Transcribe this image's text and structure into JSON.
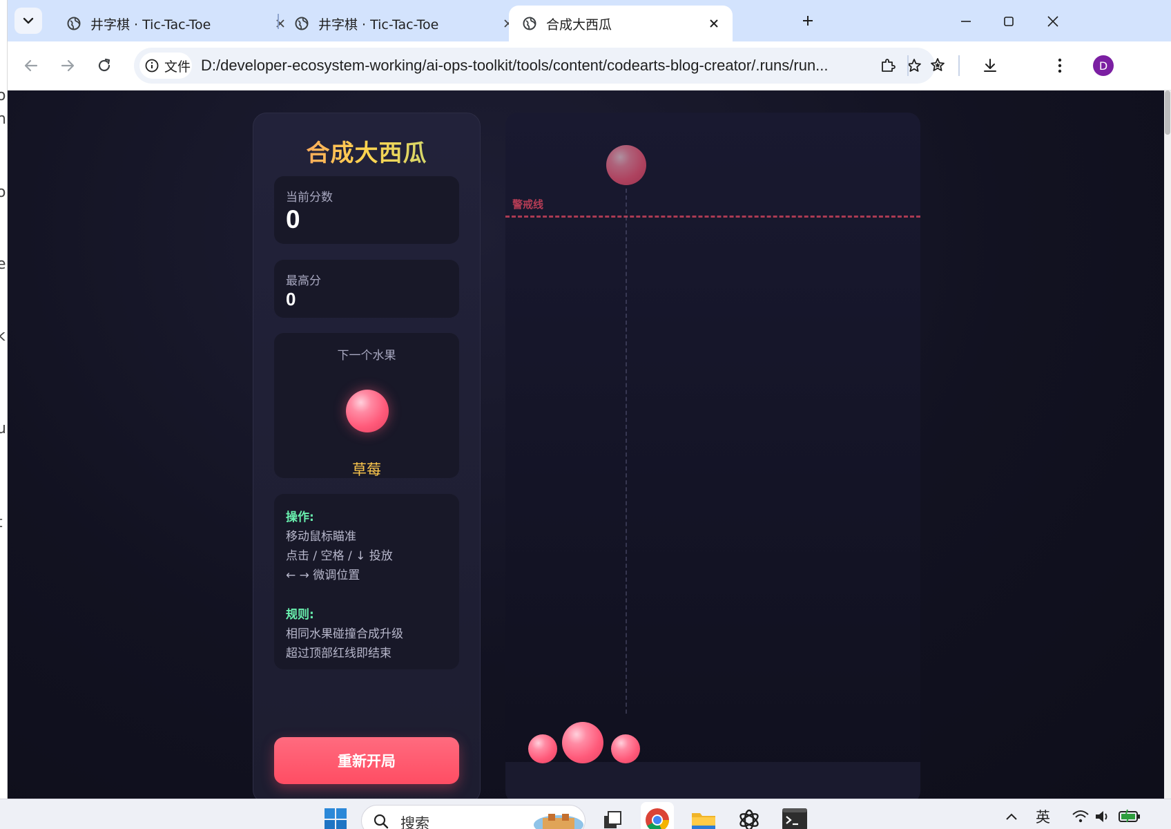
{
  "browser": {
    "tabs": [
      {
        "title": "井字棋 · Tic-Tac-Toe",
        "active": false
      },
      {
        "title": "井字棋 · Tic-Tac-Toe",
        "active": false
      },
      {
        "title": "合成大西瓜",
        "active": true
      }
    ],
    "site_chip_label": "文件",
    "url": "D:/developer-ecosystem-working/ai-ops-toolkit/tools/content/codearts-blog-creator/.runs/run...",
    "profile_initial": "D"
  },
  "game": {
    "title": "合成大西瓜",
    "score": {
      "label": "当前分数",
      "value": "0"
    },
    "best": {
      "label": "最高分",
      "value": "0"
    },
    "next_fruit": {
      "label": "下一个水果",
      "name": "草莓"
    },
    "help": {
      "controls_heading": "操作:",
      "controls": [
        "移动鼠标瞄准",
        "点击 / 空格 / ↓ 投放",
        "← → 微调位置"
      ],
      "rules_heading": "规则:",
      "rules": [
        "相同水果碰撞合成升级",
        "超过顶部红线即结束"
      ]
    },
    "restart_label": "重新开局",
    "warning_line_label": "警戒线"
  },
  "taskbar": {
    "search_label": "搜索",
    "language": "英"
  },
  "colors": {
    "accent_red": "#ff4d63",
    "fruit_pink": "#ff5a7a",
    "help_heading_green": "#69f0ae",
    "fruit_name_yellow": "#ffc94d",
    "tabstrip_blue": "#d3e3fd"
  }
}
